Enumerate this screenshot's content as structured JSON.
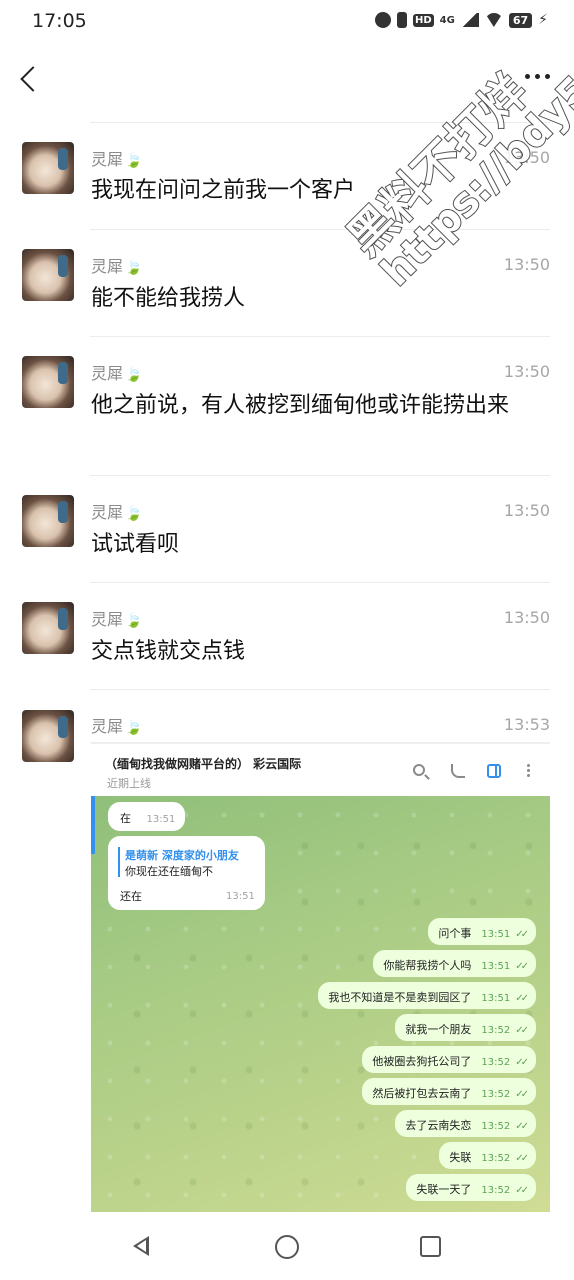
{
  "status_bar": {
    "time": "17:05",
    "network": "4G",
    "hd": "HD",
    "battery": "67"
  },
  "nav": {
    "back_icon": "chevron-left-icon",
    "more_icon": "more-dots-icon"
  },
  "messages": [
    {
      "sender": "灵犀",
      "time": "13:50",
      "text": "我现在问问之前我一个客户"
    },
    {
      "sender": "灵犀",
      "time": "13:50",
      "text": "能不能给我捞人"
    },
    {
      "sender": "灵犀",
      "time": "13:50",
      "text": "他之前说，有人被挖到缅甸他或许能捞出来"
    },
    {
      "sender": "灵犀",
      "time": "13:50",
      "text": "试试看呗"
    },
    {
      "sender": "灵犀",
      "time": "13:50",
      "text": "交点钱就交点钱"
    },
    {
      "sender": "灵犀",
      "time": "13:53",
      "text": ""
    }
  ],
  "screenshot": {
    "title": "（缅甸找我做网赌平台的） 彩云国际",
    "subtitle": "近期上线",
    "incoming": [
      {
        "text": "在",
        "time": "13:51"
      }
    ],
    "reply": {
      "quoted_name": "是萌新 深度家的小朋友",
      "quoted_text": "你现在还在缅甸不",
      "text": "还在",
      "time": "13:51"
    },
    "outgoing": [
      {
        "text": "问个事",
        "time": "13:51"
      },
      {
        "text": "你能帮我捞个人吗",
        "time": "13:51"
      },
      {
        "text": "我也不知道是不是卖到园区了",
        "time": "13:51"
      },
      {
        "text": "就我一个朋友",
        "time": "13:52"
      },
      {
        "text": "他被圈去狗托公司了",
        "time": "13:52"
      },
      {
        "text": "然后被打包去云南了",
        "time": "13:52"
      },
      {
        "text": "去了云南失恋",
        "time": "13:52"
      },
      {
        "text": "失联",
        "time": "13:52"
      },
      {
        "text": "失联一天了",
        "time": "13:52"
      }
    ]
  },
  "watermark": {
    "line1": "黑料不打烊",
    "line2": "https://bdy5.co"
  }
}
